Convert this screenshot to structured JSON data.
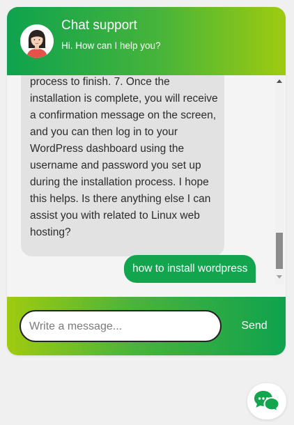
{
  "header": {
    "title": "Chat support",
    "subtitle": "Hi. How can I help you?"
  },
  "messages": [
    {
      "sender": "bot",
      "text": "process to finish. 7. Once the installation is complete, you will receive a confirmation message on the screen, and you can then log in to your WordPress dashboard using the username and password you set up during the installation process. I hope this helps. Is there anything else I can assist you with related to Linux web hosting?"
    },
    {
      "sender": "user",
      "text": "how to install wordpress"
    }
  ],
  "composer": {
    "placeholder": "Write a message...",
    "value": "",
    "send_label": "Send"
  },
  "colors": {
    "brand_green": "#12a54e",
    "brand_lime": "#9fcb0f",
    "bot_bubble": "#e2e2e2"
  },
  "icons": {
    "avatar": "support-agent-avatar",
    "launcher": "chat-bubbles-icon"
  }
}
